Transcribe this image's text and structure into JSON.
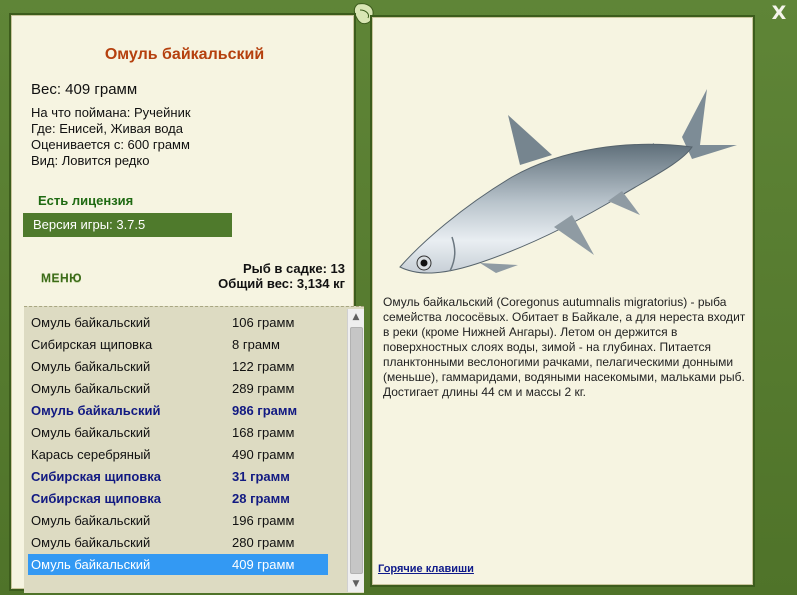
{
  "close_label": "X",
  "fish": {
    "title": "Омуль байкальский",
    "weight_line": "Вес: 409 грамм",
    "bait_line": "На что поймана: Ручейник",
    "place_line": "Где: Енисей, Живая вода",
    "value_line": "Оценивается с: 600 грамм",
    "kind_line": "Вид: Ловится редко"
  },
  "license_text": "Есть лицензия",
  "version_text": "Версия игры: 3.7.5",
  "menu_label": "МЕНЮ",
  "stats": {
    "fish_count_line": "Рыб в садке: 13",
    "total_weight_line": "Общий вес: 3,134 кг"
  },
  "catch_list": [
    {
      "name": "Омуль байкальский",
      "weight": "106 грамм",
      "bold": false
    },
    {
      "name": "Сибирская щиповка",
      "weight": "8 грамм",
      "bold": false
    },
    {
      "name": "Омуль байкальский",
      "weight": "122 грамм",
      "bold": false
    },
    {
      "name": "Омуль байкальский",
      "weight": "289 грамм",
      "bold": false
    },
    {
      "name": "Омуль байкальский",
      "weight": "986 грамм",
      "bold": true
    },
    {
      "name": "Омуль байкальский",
      "weight": "168 грамм",
      "bold": false
    },
    {
      "name": "Карась серебряный",
      "weight": "490 грамм",
      "bold": false
    },
    {
      "name": "Сибирская щиповка",
      "weight": "31 грамм",
      "bold": true
    },
    {
      "name": "Сибирская щиповка",
      "weight": "28 грамм",
      "bold": true
    },
    {
      "name": "Омуль байкальский",
      "weight": "196 грамм",
      "bold": false
    },
    {
      "name": "Омуль байкальский",
      "weight": "280 грамм",
      "bold": false
    },
    {
      "name": "Омуль байкальский",
      "weight": "409 грамм",
      "bold": false,
      "selected": true
    }
  ],
  "description": "Омуль байкальский (Coregonus autumnalis migratorius) - рыба семейства лососёвых. Обитает в Байкале, а для нереста входит в реки (кроме Нижней Ангары). Летом он держится в поверхностных слоях воды, зимой - на глубинах. Питается планктонными веслоногими рачками, пелагическими донными (меньше), гаммаридами, водяными насекомыми, мальками рыб. Достигает длины 44 см и массы 2 кг.",
  "hotkeys_label": "Горячие клавиши",
  "colors": {
    "frame_green": "#55782f",
    "panel_bg": "#f6f4e1",
    "title_color": "#b5400e",
    "selection": "#3399f3",
    "highlight_text": "#121a82"
  },
  "icons": {
    "close": "close-icon",
    "decoration": "leaf-decoration-icon"
  }
}
